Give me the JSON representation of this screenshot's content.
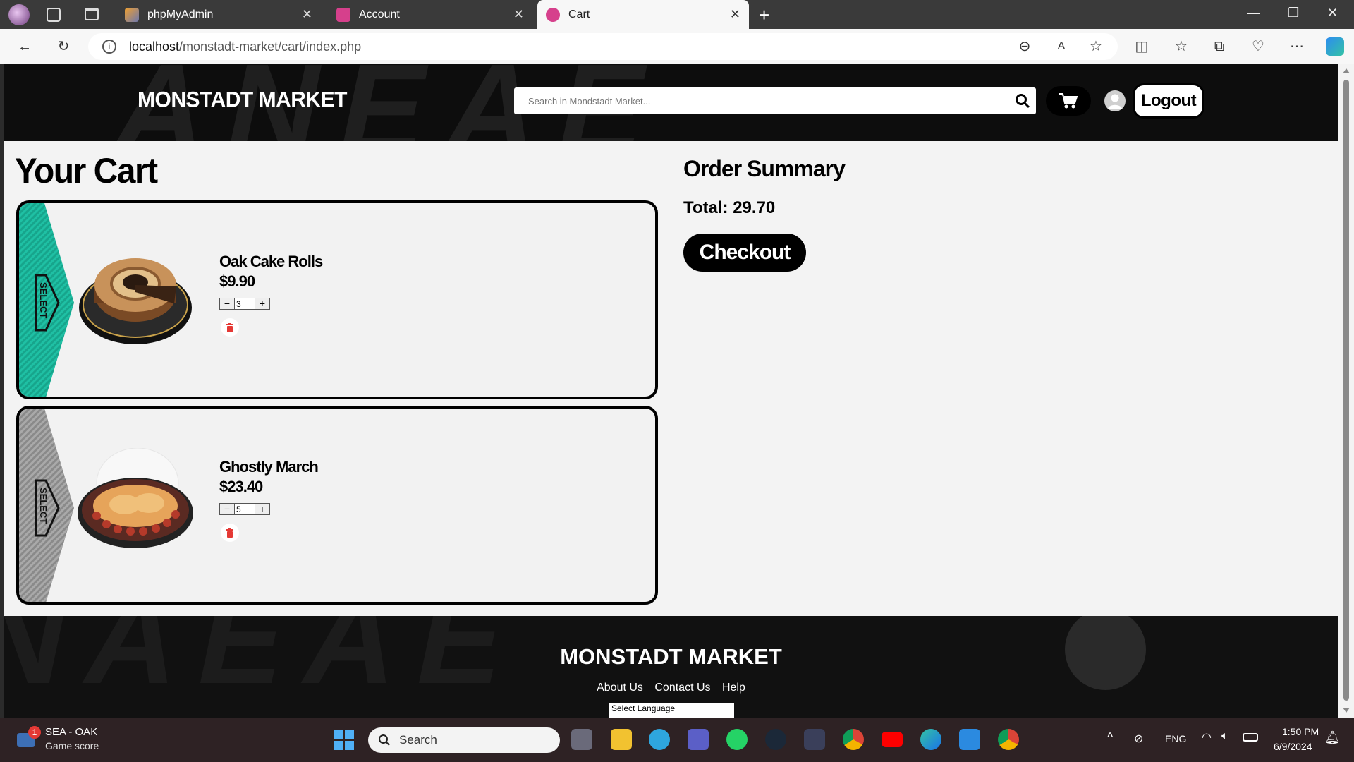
{
  "browser": {
    "tabs": [
      {
        "label": "phpMyAdmin",
        "active": false
      },
      {
        "label": "Account",
        "active": false
      },
      {
        "label": "Cart",
        "active": true
      }
    ],
    "url_host": "localhost",
    "url_path": "/monstadt-market/cart/index.php"
  },
  "header": {
    "logo": "MONSTADT MARKET",
    "search_placeholder": "Search in Mondstadt Market...",
    "logout_label": "Logout"
  },
  "cart": {
    "title": "Your Cart",
    "items": [
      {
        "name": "Oak Cake Rolls",
        "price": "$9.90",
        "quantity": "3",
        "minus": "−",
        "plus": "+"
      },
      {
        "name": "Ghostly March",
        "price": "$23.40",
        "quantity": "5",
        "minus": "−",
        "plus": "+"
      }
    ]
  },
  "summary": {
    "title": "Order Summary",
    "total": "Total: 29.70",
    "checkout_label": "Checkout"
  },
  "footer": {
    "logo": "MONSTADT MARKET",
    "links": [
      "About Us",
      "Contact Us",
      "Help"
    ],
    "language_select": "Select Language"
  },
  "taskbar": {
    "widget_title": "SEA - OAK",
    "widget_sub": "Game score",
    "widget_badge": "1",
    "search_label": "Search",
    "lang": "ENG",
    "time": "1:50 PM",
    "date": "6/9/2024"
  }
}
